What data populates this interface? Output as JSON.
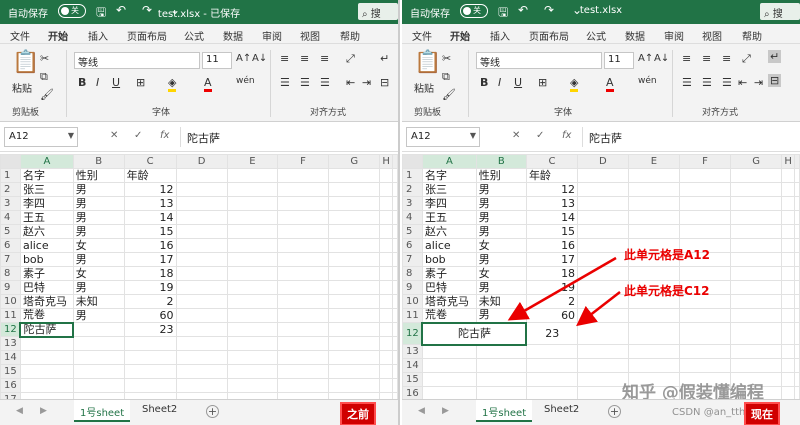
{
  "titlebar": {
    "autosave": "自动保存",
    "toggle": "关",
    "left_title": "test.xlsx - 已保存",
    "right_title": "test.xlsx",
    "search": "搜"
  },
  "ribbon_tabs": [
    "文件",
    "开始",
    "插入",
    "页面布局",
    "公式",
    "数据",
    "审阅",
    "视图",
    "帮助"
  ],
  "ribbon": {
    "paste": "粘贴",
    "clipboard": "剪贴板",
    "font_name": "等线",
    "font_size": "11",
    "font_group": "字体",
    "align_group": "对齐方式"
  },
  "formula": {
    "namebox": "A12",
    "content": "陀古萨"
  },
  "columns": [
    "A",
    "B",
    "C",
    "D",
    "E",
    "F",
    "G",
    "H"
  ],
  "rows": [
    [
      "名字",
      "性别",
      "年龄"
    ],
    [
      "张三",
      "男",
      "12"
    ],
    [
      "李四",
      "男",
      "13"
    ],
    [
      "王五",
      "男",
      "14"
    ],
    [
      "赵六",
      "男",
      "15"
    ],
    [
      "alice",
      "女",
      "16"
    ],
    [
      "bob",
      "男",
      "17"
    ],
    [
      "素子",
      "女",
      "18"
    ],
    [
      "巴特",
      "男",
      "19"
    ],
    [
      "塔奇克马",
      "未知",
      "2"
    ],
    [
      "荒卷",
      "男",
      "60"
    ],
    [
      "陀古萨",
      "",
      "23"
    ],
    [
      "",
      "",
      ""
    ],
    [
      "",
      "",
      ""
    ],
    [
      "",
      "",
      ""
    ],
    [
      "",
      "",
      ""
    ],
    [
      "",
      "",
      ""
    ]
  ],
  "right_rows": [
    [
      "名字",
      "性别",
      "年龄"
    ],
    [
      "张三",
      "男",
      "12"
    ],
    [
      "李四",
      "男",
      "13"
    ],
    [
      "王五",
      "男",
      "14"
    ],
    [
      "赵六",
      "男",
      "15"
    ],
    [
      "alice",
      "女",
      "16"
    ],
    [
      "bob",
      "男",
      "17"
    ],
    [
      "素子",
      "女",
      "18"
    ],
    [
      "巴特",
      "男",
      "19"
    ],
    [
      "塔奇克马",
      "未知",
      "2"
    ],
    [
      "荒卷",
      "男",
      "60"
    ],
    [
      "陀古萨",
      "",
      "23"
    ],
    [
      "",
      "",
      ""
    ],
    [
      "",
      "",
      ""
    ],
    [
      "",
      "",
      ""
    ],
    [
      "",
      "",
      ""
    ]
  ],
  "sheets": {
    "tab1": "1号sheet",
    "tab2": "Sheet2"
  },
  "labels": {
    "before": "之前",
    "now": "现在",
    "annot_a12": "此单元格是A12",
    "annot_c12": "此单元格是C12"
  },
  "watermark": {
    "zhihu": "知乎 @假装懂编程",
    "csdn": "CSDN @an_tth"
  },
  "colors": {
    "excel_green": "#217346",
    "annotation_red": "#ea0000"
  }
}
